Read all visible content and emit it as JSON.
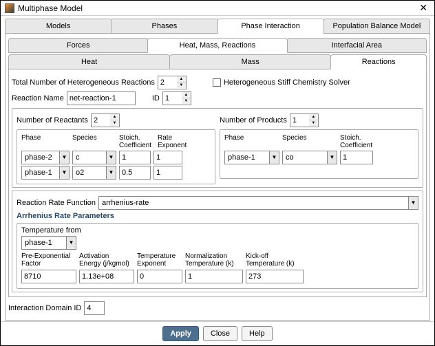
{
  "window": {
    "title": "Multiphase Model"
  },
  "tabs_outer": {
    "t0": "Models",
    "t1": "Phases",
    "t2": "Phase Interaction",
    "t3": "Population Balance Model"
  },
  "tabs_inner": {
    "t0": "Forces",
    "t1": "Heat, Mass, Reactions",
    "t2": "Interfacial Area"
  },
  "tabs_inner2": {
    "t0": "Heat",
    "t1": "Mass",
    "t2": "Reactions"
  },
  "totals": {
    "total_label": "Total Number of Heterogeneous Reactions",
    "total_val": "2",
    "stiff_label": "Heterogeneous Stiff Chemistry Solver",
    "rxname_label": "Reaction Name",
    "rxname_val": "net-reaction-1",
    "id_label": "ID",
    "id_val": "1"
  },
  "reactants": {
    "num_label": "Number of Reactants",
    "num_val": "2",
    "h_phase": "Phase",
    "h_species": "Species",
    "h_stoich": "Stoich.\nCoefficient",
    "h_rate": "Rate\nExponent",
    "r0": {
      "phase": "phase-2",
      "species": "c",
      "stoich": "1",
      "rate": "1"
    },
    "r1": {
      "phase": "phase-1",
      "species": "o2",
      "stoich": "0.5",
      "rate": "1"
    }
  },
  "products": {
    "num_label": "Number of Products",
    "num_val": "1",
    "h_phase": "Phase",
    "h_species": "Species",
    "h_stoich": "Stoich.\nCoefficient",
    "r0": {
      "phase": "phase-1",
      "species": "co",
      "stoich": "1"
    }
  },
  "ratefunc": {
    "label": "Reaction Rate Function",
    "val": "arrhenius-rate"
  },
  "arr": {
    "title": "Arrhenius Rate Parameters",
    "temp_from_label": "Temperature from",
    "temp_from_val": "phase-1",
    "h_pre": "Pre-Exponential\nFactor",
    "h_act": "Activation\nEnergy (j/kgmol)",
    "h_texp": "Temperature\nExponent",
    "h_norm": "Normalization\nTemperature (k)",
    "h_kick": "Kick-off\nTemperature (k)",
    "v_pre": "8710",
    "v_act": "1.13e+08",
    "v_texp": "0",
    "v_norm": "1",
    "v_kick": "273"
  },
  "domain": {
    "label": "Interaction Domain ID",
    "val": "4"
  },
  "buttons": {
    "apply": "Apply",
    "close": "Close",
    "help": "Help"
  }
}
